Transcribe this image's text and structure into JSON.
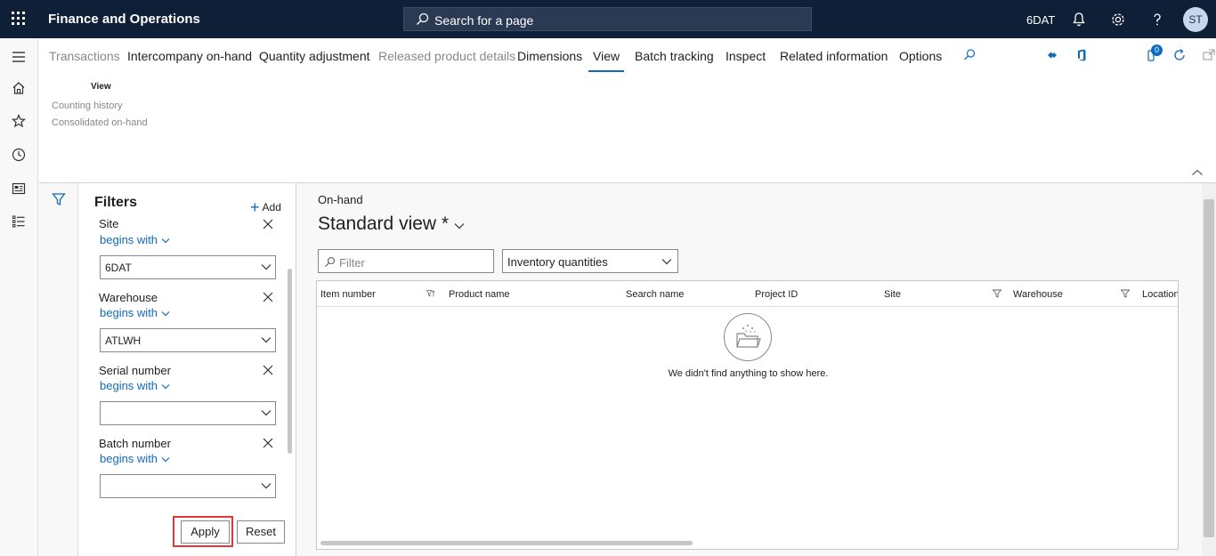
{
  "app": {
    "title": "Finance and Operations"
  },
  "search": {
    "label": "Search for a page"
  },
  "topbar": {
    "company": "6DAT",
    "avatar_initials": "ST"
  },
  "tabs": [
    {
      "label": "Transactions",
      "state": "disabled"
    },
    {
      "label": "Intercompany on-hand",
      "state": "enabled"
    },
    {
      "label": "Quantity adjustment",
      "state": "enabled"
    },
    {
      "label": "Released product details",
      "state": "disabled"
    },
    {
      "label": "Dimensions",
      "state": "enabled"
    },
    {
      "label": "View",
      "state": "active"
    },
    {
      "label": "Batch tracking",
      "state": "enabled"
    },
    {
      "label": "Inspect",
      "state": "enabled"
    },
    {
      "label": "Related information",
      "state": "enabled"
    },
    {
      "label": "Options",
      "state": "enabled"
    }
  ],
  "action_group": {
    "title": "View",
    "items": [
      "Counting history",
      "Consolidated on-hand"
    ]
  },
  "notifications": {
    "count": "0"
  },
  "filters": {
    "title": "Filters",
    "add_label": "Add",
    "fields": [
      {
        "label": "Site",
        "operator": "begins with",
        "value": "6DAT"
      },
      {
        "label": "Warehouse",
        "operator": "begins with",
        "value": "ATLWH"
      },
      {
        "label": "Serial number",
        "operator": "begins with",
        "value": ""
      },
      {
        "label": "Batch number",
        "operator": "begins with",
        "value": ""
      }
    ],
    "apply_label": "Apply",
    "reset_label": "Reset"
  },
  "main": {
    "breadcrumb": "On-hand",
    "view_title": "Standard view *",
    "grid_filter_placeholder": "Filter",
    "quantity_view": "Inventory quantities",
    "columns": [
      "Item number",
      "Product name",
      "Search name",
      "Project ID",
      "Site",
      "Warehouse",
      "Location"
    ],
    "empty_message": "We didn't find anything to show here."
  },
  "colors": {
    "topbar": "#0f1f38",
    "accent": "#0f6cbd",
    "highlight": "#e0373b"
  }
}
